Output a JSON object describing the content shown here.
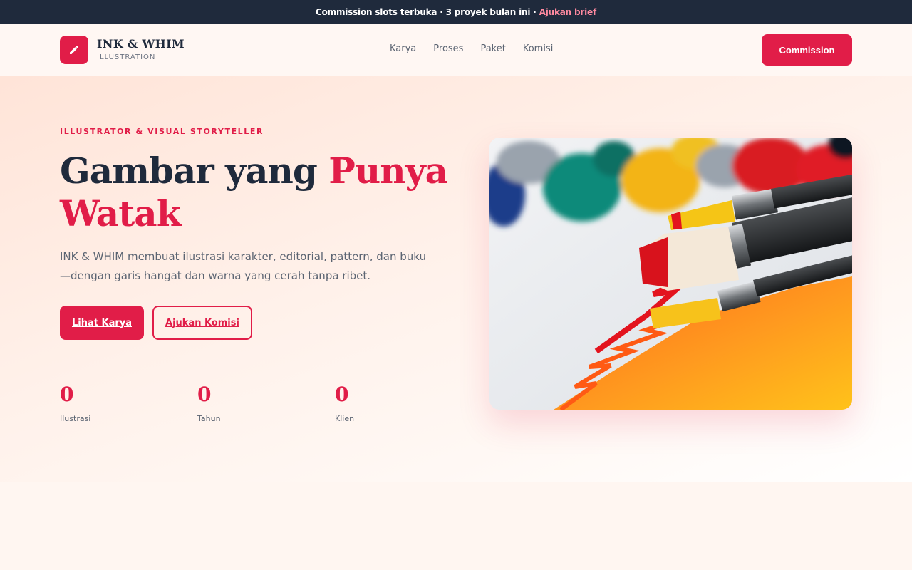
{
  "announcement": {
    "text": "Commission slots terbuka",
    "separator": "·",
    "detail": "3 proyek bulan ini",
    "link": "Ajukan brief"
  },
  "brand": {
    "name": "INK & WHIM",
    "sub": "ILLUSTRATION",
    "icon": "pencil-icon"
  },
  "nav": {
    "links": [
      "Karya",
      "Proses",
      "Paket",
      "Komisi"
    ],
    "cta": "Commission"
  },
  "hero": {
    "eyebrow": "ILLUSTRATOR & VISUAL STORYTELLER",
    "headline_plain": "Gambar yang",
    "headline_accent": "Punya Watak",
    "description": "INK & WHIM membuat ilustrasi karakter, editorial, pattern, dan buku—dengan garis hangat dan warna yang cerah tanpa ribet.",
    "primary_button": "Lihat Karya",
    "secondary_button": "Ajukan Komisi",
    "image": "paintbrushes-with-paint-photo"
  },
  "stats": [
    {
      "value": "0",
      "label": "Ilustrasi"
    },
    {
      "value": "0",
      "label": "Tahun"
    },
    {
      "value": "0",
      "label": "Klien"
    }
  ],
  "colors": {
    "accent": "#e11d48",
    "dark": "#1f2a3c",
    "muted": "#5b6472"
  }
}
